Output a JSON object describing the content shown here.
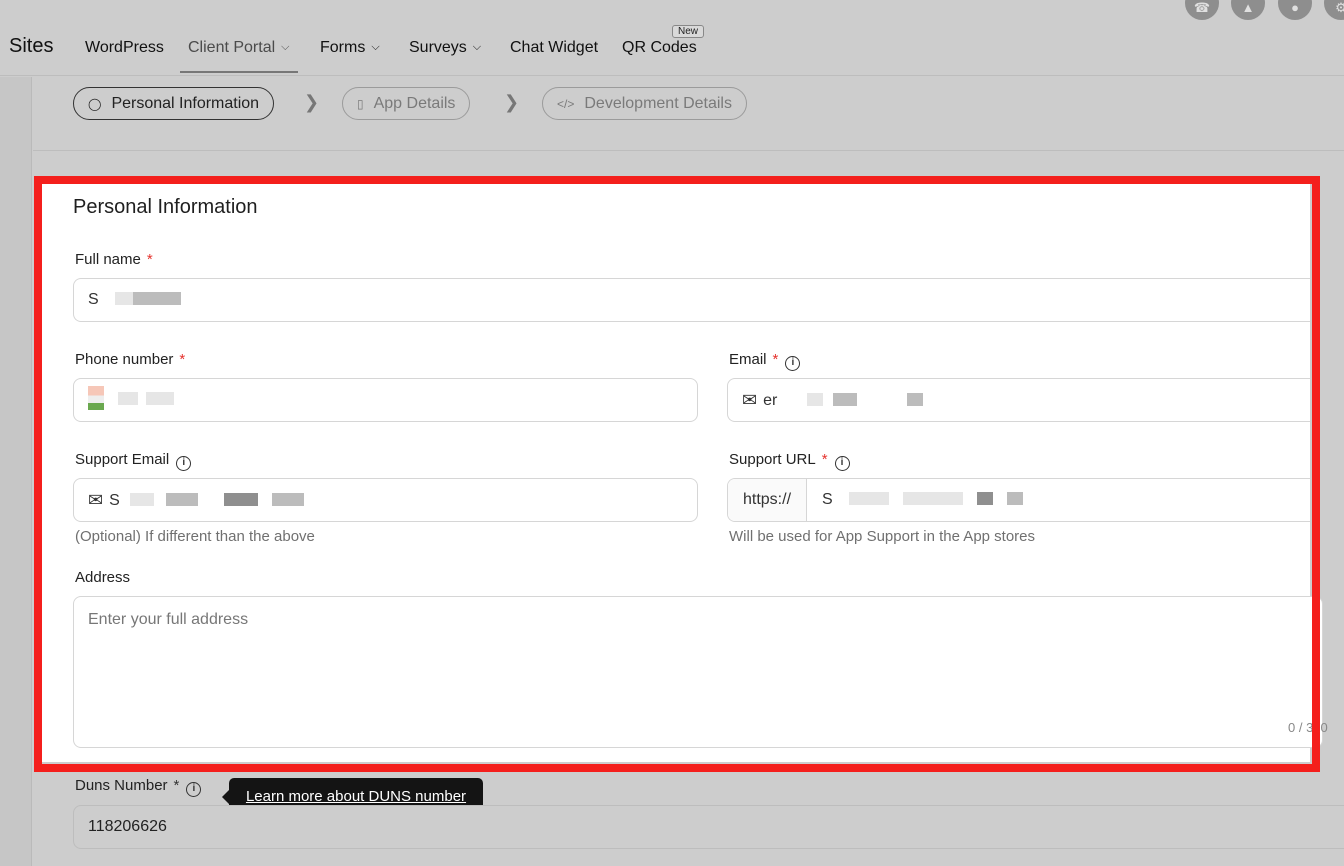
{
  "nav": {
    "brand": "Sites",
    "items": [
      {
        "label": "WordPress"
      },
      {
        "label": "Client Portal"
      },
      {
        "label": "Forms"
      },
      {
        "label": "Surveys"
      },
      {
        "label": "Chat Widget"
      },
      {
        "label": "QR Codes"
      }
    ],
    "new_badge": "New",
    "active_item": "Client Portal"
  },
  "steps": [
    {
      "label": "Personal Information",
      "icon": "user-icon",
      "state": "current"
    },
    {
      "label": "App Details",
      "icon": "phone-icon",
      "state": "todo"
    },
    {
      "label": "Development Details",
      "icon": "code-icon",
      "state": "todo"
    }
  ],
  "form": {
    "title": "Personal Information",
    "full_name": {
      "label": "Full name",
      "value": "S"
    },
    "phone": {
      "label": "Phone number"
    },
    "email": {
      "label": "Email",
      "value": "er"
    },
    "support_email": {
      "label": "Support Email",
      "value": "S",
      "hint": "(Optional) If different than the above"
    },
    "support_url": {
      "label": "Support URL",
      "prefix": "https://",
      "value": "S",
      "hint": "Will be used for App Support in the App stores"
    },
    "address": {
      "label": "Address",
      "placeholder": "Enter your full address",
      "counter": "0 / 300"
    },
    "required_mark": "*"
  },
  "duns": {
    "label": "Duns Number",
    "tooltip": "Learn more about DUNS number",
    "value": "118206626"
  },
  "colors": {
    "highlight_frame": "#f41f1c",
    "required": "#e5322d"
  }
}
